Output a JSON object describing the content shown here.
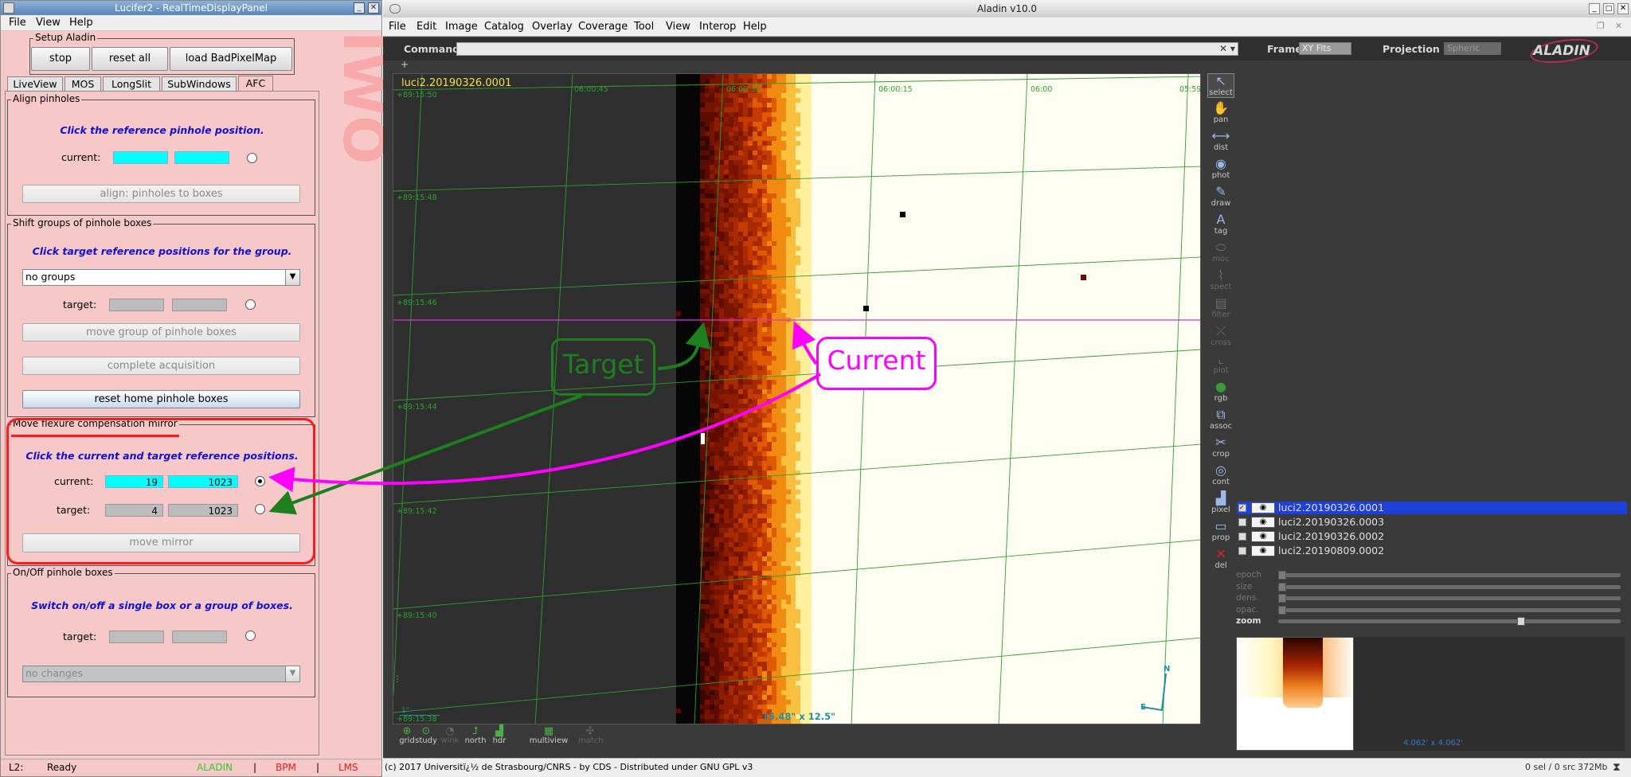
{
  "left_window": {
    "title": "Lucifer2 - RealTimeDisplayPanel",
    "menu": [
      "File",
      "View",
      "Help"
    ],
    "setup": {
      "legend": "Setup Aladin",
      "buttons": [
        "stop",
        "reset all",
        "load BadPixelMap"
      ]
    },
    "tabs": [
      "LiveView",
      "MOS",
      "LongSlit",
      "SubWindows",
      "AFC"
    ],
    "align": {
      "legend": "Align pinholes",
      "instruction": "Click the reference pinhole position.",
      "current_label": "current:",
      "button": "align: pinholes to boxes"
    },
    "shift": {
      "legend": "Shift groups of pinhole boxes",
      "instruction": "Click target reference positions for the group.",
      "dropdown": "no groups",
      "target_label": "target:",
      "button_move": "move group of pinhole boxes",
      "button_complete": "complete acquisition",
      "button_reset": "reset home pinhole boxes"
    },
    "mirror": {
      "legend": "Move flexure compensation mirror",
      "instruction": "Click the current and target reference positions.",
      "current_label": "current:",
      "current_x": "19",
      "current_y": "1023",
      "target_label": "target:",
      "target_x": "4",
      "target_y": "1023",
      "button": "move mirror"
    },
    "onoff": {
      "legend": "On/Off pinhole boxes",
      "instruction": "Switch on/off a single box or a group of boxes.",
      "target_label": "target:",
      "dropdown": "no changes"
    },
    "status": {
      "instrument": "L2:",
      "state": "Ready",
      "aladin": "ALADIN",
      "sep1": "|",
      "bpm": "BPM",
      "sep2": "|",
      "lms": "LMS"
    },
    "watermark": "IWO"
  },
  "right_window": {
    "title": "Aladin v10.0",
    "menu": [
      "File",
      "Edit",
      "Image",
      "Catalog",
      "Overlay",
      "Coverage",
      "Tool",
      "View",
      "Interop",
      "Help"
    ],
    "command_label": "Command",
    "frame_label": "Frame",
    "frame_value": "XY Fits",
    "projection_label": "Projection",
    "projection_value": "Spheric",
    "logo": "ALADIN",
    "image_label": "luci2.20190326.0001",
    "ra_ticks": [
      "06:00:45",
      "06:00:30",
      "06:00:15",
      "06:00",
      "05:59"
    ],
    "dec_ticks": [
      "+89:15:50",
      "+89:15:48",
      "+89:15:46",
      "+89:15:44",
      "+89:15:42",
      "+89:15:40",
      "+89:15:38"
    ],
    "fov": "15.48\" x 12.5\"",
    "scale": "1\"",
    "compass": {
      "n": "N",
      "e": "E"
    },
    "annotations": {
      "target": "Target",
      "current": "Current"
    },
    "tools": [
      "select",
      "pan",
      "dist",
      "phot",
      "draw",
      "tag",
      "moc",
      "spect",
      "filter",
      "cross",
      "plot",
      "rgb",
      "assoc",
      "crop",
      "cont",
      "pixel",
      "prop",
      "del"
    ],
    "layers": [
      {
        "name": "luci2.20190326.0001",
        "selected": true
      },
      {
        "name": "luci2.20190326.0003",
        "selected": false
      },
      {
        "name": "luci2.20190326.0002",
        "selected": false
      },
      {
        "name": "luci2.20190809.0002",
        "selected": false
      }
    ],
    "sliders": [
      "epoch",
      "size",
      "dens.",
      "opac.",
      "zoom"
    ],
    "thumb_fov": "4.062' x 4.062'",
    "bottom_tools": [
      "grid",
      "study",
      "wink",
      "north",
      "hdr",
      "multiview",
      "match"
    ],
    "status_left": "(c) 2017 Universitï¿½ de Strasbourg/CNRS - by CDS - Distributed under GNU GPL v3",
    "status_right": "0 sel / 0 src",
    "memory": "372Mb"
  },
  "colors": {
    "pink_bg": "#f6c8c8",
    "cyan_field": "#00ffff",
    "instruction_blue": "#1010d8",
    "highlight_red": "#ff1a1a",
    "target_green": "#1e7f1e",
    "current_magenta": "#ff00ff",
    "layer_select": "#1e3fd8"
  }
}
